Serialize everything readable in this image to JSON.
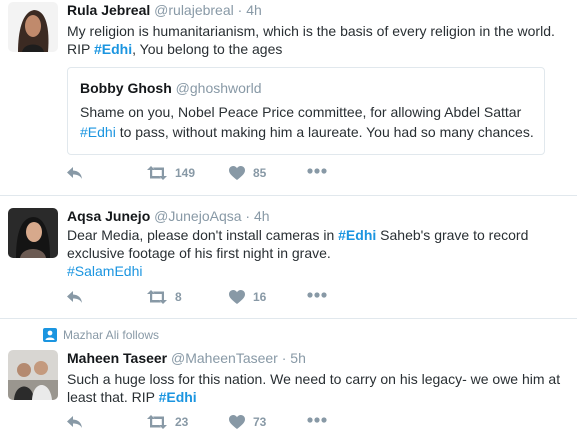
{
  "tweets": [
    {
      "name": "Rula Jebreal",
      "handle": "@rulajebreal",
      "sep": "·",
      "time": "4h",
      "text1": "My religion is humanitarianism, which is the basis of every religion in the world.",
      "text2a": "RIP ",
      "tag1": "#Edhi",
      "text2b": ", You belong to the ages",
      "quote": {
        "name": "Bobby Ghosh",
        "handle": "@ghoshworld",
        "line1": "Shame on you, Nobel Peace Price committee, for allowing Abdel Sattar",
        "line2_tag": "#Edhi",
        "line2_rest": " to pass, without making him a laureate. You had so many chances."
      },
      "retweets": "149",
      "likes": "85"
    },
    {
      "name": "Aqsa Junejo",
      "handle": "@JunejoAqsa",
      "sep": "·",
      "time": "4h",
      "text1a": "Dear Media, please don't install cameras in ",
      "tag1": "#Edhi",
      "text1b": " Saheb's grave to record",
      "text2": "exclusive footage of his first night in grave.",
      "tag2": "#SalamEdhi",
      "retweets": "8",
      "likes": "16"
    },
    {
      "social_context": "Mazhar Ali follows",
      "name": "Maheen Taseer",
      "handle": "@MaheenTaseer",
      "sep": "·",
      "time": "5h",
      "text1": "Such a huge loss for this nation. We need to carry on his legacy- we owe him at",
      "text2a": "least that. RIP ",
      "tag1": "#Edhi",
      "retweets": "23",
      "likes": "73"
    }
  ],
  "icons": {
    "reply": "reply-icon",
    "retweet": "retweet-icon",
    "like": "heart-icon",
    "more": "more-icon"
  },
  "colors": {
    "link": "#1b95e0",
    "muted": "#8899a6",
    "divider": "#e1e8ed"
  }
}
